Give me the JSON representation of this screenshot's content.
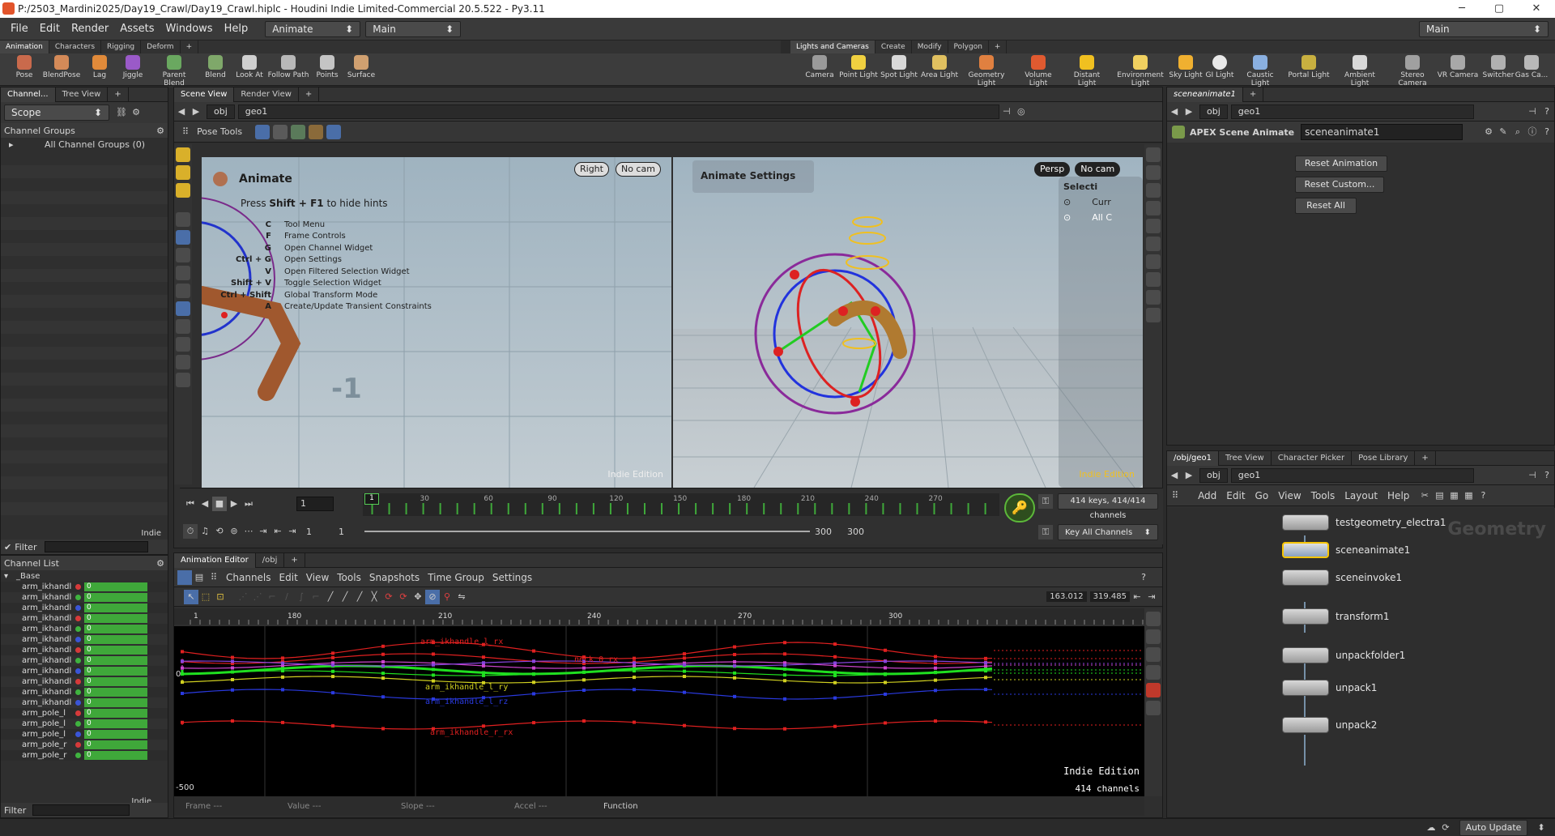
{
  "window": {
    "title": "P:/2503_Mardini2025/Day19_Crawl/Day19_Crawl.hiplc - Houdini Indie Limited-Commercial 20.5.522 - Py3.11",
    "min": "─",
    "max": "▢",
    "close": "✕"
  },
  "menu": {
    "items": [
      "File",
      "Edit",
      "Render",
      "Assets",
      "Windows",
      "Help"
    ],
    "desktop": "Animate",
    "context": "Main",
    "right_desktop": "Main"
  },
  "shelf_tabs_left": [
    "Animation",
    "Characters",
    "Rigging",
    "Deform"
  ],
  "shelf_tabs_right": [
    "Lights and Cameras",
    "Create",
    "Modify",
    "Polygon"
  ],
  "shelf_tools_left": [
    "Pose",
    "BlendPose",
    "Lag",
    "Jiggle",
    "Parent Blend",
    "Blend",
    "Look At",
    "Follow Path",
    "Points",
    "Surface"
  ],
  "shelf_tools_right": [
    "Camera",
    "Point Light",
    "Spot Light",
    "Area Light",
    "Geometry Light",
    "Volume Light",
    "Distant Light",
    "Environment Light",
    "Sky Light",
    "GI Light",
    "Caustic Light",
    "Portal Light",
    "Ambient Light",
    "Stereo Camera",
    "VR Camera",
    "Switcher",
    "Gas Ca..."
  ],
  "colors": {
    "accent": "#f5c400",
    "bg": "#2b2b2b",
    "green_key": "#3fa83a",
    "viewport_sky": "#a8bcc8"
  },
  "left_panel": {
    "tabs": [
      "Channel...",
      "Tree View"
    ],
    "scope": "Scope",
    "groups_header": "Channel Groups",
    "groups_item": "All Channel Groups (0)",
    "indie": "Indie",
    "filter": "Filter",
    "channel_list": "Channel List",
    "base": "_Base",
    "filter2": "Filter"
  },
  "channels": [
    {
      "name": "arm_ikhandl",
      "dot": "#d63a3a",
      "v": "0"
    },
    {
      "name": "arm_ikhandl",
      "dot": "#3fb33f",
      "v": "0"
    },
    {
      "name": "arm_ikhandl",
      "dot": "#3a55d6",
      "v": "0"
    },
    {
      "name": "arm_ikhandl",
      "dot": "#d63a3a",
      "v": "0"
    },
    {
      "name": "arm_ikhandl",
      "dot": "#3fb33f",
      "v": "0"
    },
    {
      "name": "arm_ikhandl",
      "dot": "#3a55d6",
      "v": "0"
    },
    {
      "name": "arm_ikhandl",
      "dot": "#d63a3a",
      "v": "0"
    },
    {
      "name": "arm_ikhandl",
      "dot": "#3fb33f",
      "v": "0"
    },
    {
      "name": "arm_ikhandl",
      "dot": "#3a55d6",
      "v": "0"
    },
    {
      "name": "arm_ikhandl",
      "dot": "#d63a3a",
      "v": "0"
    },
    {
      "name": "arm_ikhandl",
      "dot": "#3fb33f",
      "v": "0"
    },
    {
      "name": "arm_ikhandl",
      "dot": "#3a55d6",
      "v": "0"
    },
    {
      "name": "arm_pole_l",
      "dot": "#d63a3a",
      "v": "0"
    },
    {
      "name": "arm_pole_l",
      "dot": "#3fb33f",
      "v": "0"
    },
    {
      "name": "arm_pole_l",
      "dot": "#3a55d6",
      "v": "0"
    },
    {
      "name": "arm_pole_r",
      "dot": "#d63a3a",
      "v": "0"
    },
    {
      "name": "arm_pole_r",
      "dot": "#3fb33f",
      "v": "0"
    }
  ],
  "viewer": {
    "tabs": [
      "Scene View",
      "Render View"
    ],
    "path": [
      "obj",
      "geo1"
    ],
    "pose_tools": "Pose Tools",
    "left_cam": "Right",
    "left_nocam": "No cam",
    "right_persp": "Persp",
    "right_nocam": "No cam",
    "animate_title": "Animate",
    "hint_pre": "Press ",
    "hint_key": "Shift + F1",
    "hint_post": " to hide hints",
    "hints": [
      [
        "C",
        "Tool Menu"
      ],
      [
        "F",
        "Frame Controls"
      ],
      [
        "G",
        "Open Channel Widget"
      ],
      [
        "Ctrl + G",
        "Open Settings"
      ],
      [
        "V",
        "Open Filtered Selection Widget"
      ],
      [
        "Shift + V",
        "Toggle Selection Widget"
      ],
      [
        "Ctrl + Shift",
        "Global Transform Mode"
      ],
      [
        "A",
        "Create/Update Transient Constraints"
      ]
    ],
    "animate_settings": "Animate Settings",
    "selection": "Selecti",
    "sel_curr": "Curr",
    "sel_all": "All C",
    "indie": "Indie Edition",
    "axis_label": "-1"
  },
  "timeline": {
    "frame": "1",
    "ticks": [
      "30",
      "60",
      "90",
      "120",
      "150",
      "180",
      "210",
      "240",
      "270"
    ],
    "keys_info": "414 keys, 414/414 channels",
    "key_all": "Key All Channels",
    "start": "1",
    "start2": "1",
    "end": "300",
    "end2": "300",
    "marker": "1"
  },
  "anim_editor": {
    "tabs": [
      "Animation Editor",
      "/obj"
    ],
    "menu": [
      "Channels",
      "Edit",
      "View",
      "Tools",
      "Snapshots",
      "Time Group",
      "Settings"
    ],
    "range": "163.012",
    "range2": "319.485",
    "ruler": [
      "1",
      "180",
      "210",
      "240",
      "270",
      "300"
    ],
    "zero": "0",
    "minus": "-500",
    "indie": "Indie Edition",
    "chcount": "414 channels",
    "curve_labels": [
      "arm_ikhandle_l_rx",
      "neck_0_rx",
      "arm_ikhandle_l_ry",
      "arm_ikhandle_l_rz",
      "arm_ikhandle_r_rx"
    ],
    "fields": [
      "Frame",
      "Value",
      "Slope",
      "Accel",
      "Function"
    ],
    "dashes": "---"
  },
  "params": {
    "tab": "sceneanimate1",
    "path": [
      "obj",
      "geo1"
    ],
    "node_type": "APEX Scene Animate",
    "node_name": "sceneanimate1",
    "buttons": [
      "Reset Animation",
      "Reset Custom...",
      "Reset All"
    ]
  },
  "network": {
    "tabs": [
      "/obj/geo1",
      "Tree View",
      "Character Picker",
      "Pose Library"
    ],
    "path": [
      "obj",
      "geo1"
    ],
    "menu": [
      "Add",
      "Edit",
      "Go",
      "View",
      "Tools",
      "Layout",
      "Help"
    ],
    "watermark": "Geometry",
    "nodes": [
      "testgeometry_electra1",
      "sceneanimate1",
      "sceneinvoke1",
      "transform1",
      "unpackfolder1",
      "unpack1",
      "unpack2"
    ]
  },
  "status": {
    "auto_update": "Auto Update"
  }
}
